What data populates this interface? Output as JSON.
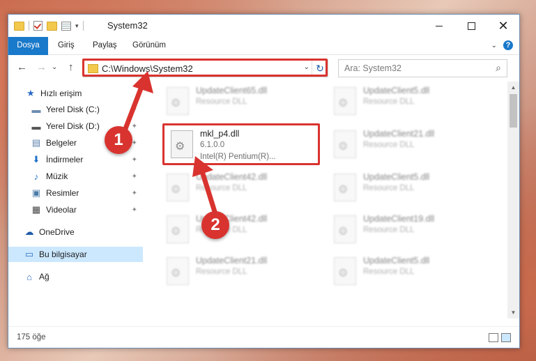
{
  "window": {
    "title": "System32",
    "qat_dropdown": "▾"
  },
  "ribbon": {
    "tabs": [
      "Dosya",
      "Giriş",
      "Paylaş",
      "Görünüm"
    ],
    "collapse": "⌄",
    "help": "?"
  },
  "nav": {
    "back": "←",
    "forward": "→",
    "recent": "⌄",
    "up": "↑",
    "address": "C:\\Windows\\System32",
    "address_dropdown": "⌄",
    "refresh": "↻",
    "search_placeholder": "Ara: System32",
    "search_icon": "⌕"
  },
  "sidebar": {
    "items": [
      {
        "label": "Hızlı erişim",
        "icon": "star-icon",
        "glyph": "★",
        "color": "#2b6cc4",
        "pinned": false
      },
      {
        "label": "Yerel Disk (C:)",
        "icon": "drive-icon",
        "glyph": "▬",
        "color": "#6b8caf",
        "pinned": true
      },
      {
        "label": "Yerel Disk (D:)",
        "icon": "drive-icon",
        "glyph": "▬",
        "color": "#555",
        "pinned": true
      },
      {
        "label": "Belgeler",
        "icon": "documents-icon",
        "glyph": "▤",
        "color": "#5a7fa8",
        "pinned": true
      },
      {
        "label": "İndirmeler",
        "icon": "download-icon",
        "glyph": "⬇",
        "color": "#1f73c7",
        "pinned": true
      },
      {
        "label": "Müzik",
        "icon": "music-icon",
        "glyph": "♪",
        "color": "#1f73c7",
        "pinned": true
      },
      {
        "label": "Resimler",
        "icon": "pictures-icon",
        "glyph": "▣",
        "color": "#4a7aa8",
        "pinned": true
      },
      {
        "label": "Videolar",
        "icon": "videos-icon",
        "glyph": "▦",
        "color": "#444",
        "pinned": true
      },
      {
        "label": "OneDrive",
        "icon": "cloud-icon",
        "glyph": "☁",
        "color": "#1e5aa8",
        "pinned": false
      },
      {
        "label": "Bu bilgisayar",
        "icon": "computer-icon",
        "glyph": "▭",
        "color": "#2b6cc4",
        "pinned": false
      },
      {
        "label": "Ağ",
        "icon": "network-icon",
        "glyph": "⌂",
        "color": "#2b6cc4",
        "pinned": false
      }
    ],
    "pin_glyph": "📌"
  },
  "files": [
    {
      "name": "UpdateClient65.dll",
      "sub": "Resource DLL",
      "highlight": false
    },
    {
      "name": "UpdateClient5.dll",
      "sub": "Resource DLL",
      "highlight": false
    },
    {
      "name": "mkl_p4.dll",
      "sub": "6.1.0.0",
      "sub2": "Intel(R) Pentium(R)...",
      "highlight": true
    },
    {
      "name": "UpdateClient21.dll",
      "sub": "Resource DLL",
      "highlight": false
    },
    {
      "name": "UpdateClient42.dll",
      "sub": "Resource DLL",
      "highlight": false
    },
    {
      "name": "UpdateClient5.dll",
      "sub": "Resource DLL",
      "highlight": false
    },
    {
      "name": "UpdateClient42.dll",
      "sub": "Resource DLL",
      "highlight": false
    },
    {
      "name": "UpdateClient19.dll",
      "sub": "Resource DLL",
      "highlight": false
    },
    {
      "name": "UpdateClient21.dll",
      "sub": "Resource DLL",
      "highlight": false
    },
    {
      "name": "UpdateClient5.dll",
      "sub": "Resource DLL",
      "highlight": false
    }
  ],
  "status": {
    "count": "175 öğe"
  },
  "annotations": {
    "badge1": "1",
    "badge2": "2",
    "color": "#d9332f"
  }
}
